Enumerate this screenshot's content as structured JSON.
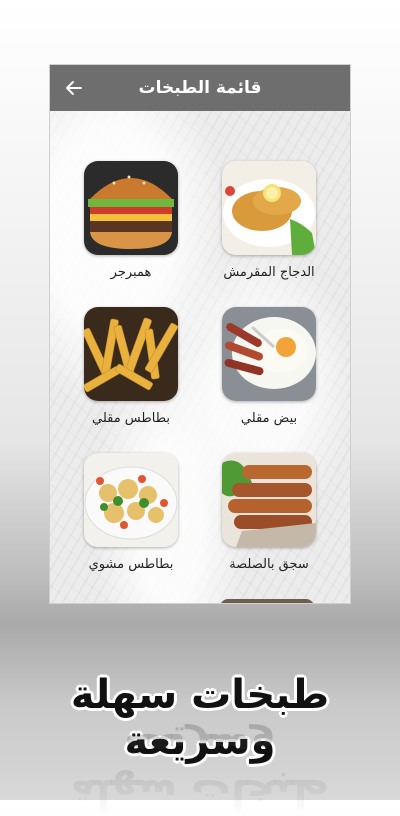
{
  "appbar": {
    "title": "قائمة الطبخات",
    "back_icon": "arrow-left-icon"
  },
  "dishes": [
    {
      "label": "الدجاج المقرمش",
      "image": "fried-chicken-image"
    },
    {
      "label": "همبرجر",
      "image": "hamburger-image"
    },
    {
      "label": "بيض مقلي",
      "image": "fried-egg-image"
    },
    {
      "label": "بطاطس مقلي",
      "image": "french-fries-image"
    },
    {
      "label": "سجق بالصلصة",
      "image": "sausage-image"
    },
    {
      "label": "بطاطس مشوي",
      "image": "roasted-potatoes-image"
    }
  ],
  "promo": {
    "text": "طبخات سهلة وسريعة"
  },
  "colors": {
    "appbar": "#6e6e6e",
    "appbar_text": "#ffffff"
  }
}
